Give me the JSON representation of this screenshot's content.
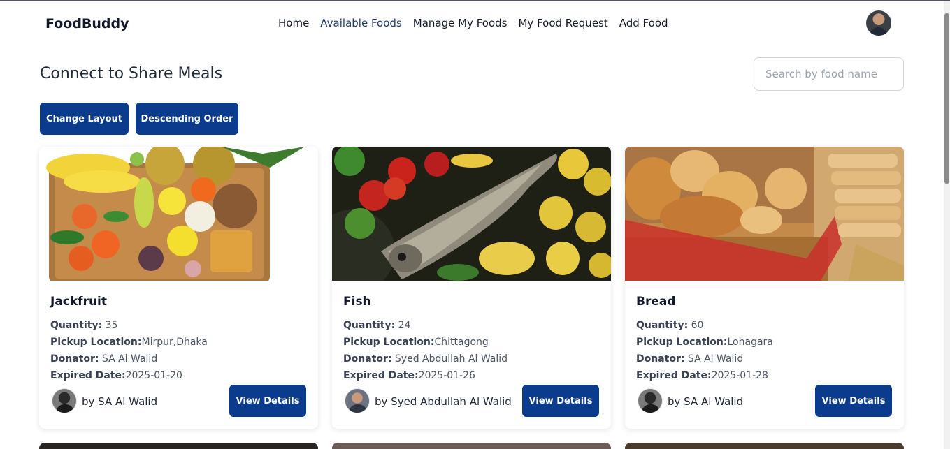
{
  "nav": {
    "brand": "FoodBuddy",
    "links": [
      {
        "label": "Home"
      },
      {
        "label": "Available Foods"
      },
      {
        "label": "Manage My Foods"
      },
      {
        "label": "My Food Request"
      },
      {
        "label": "Add Food"
      }
    ]
  },
  "page": {
    "heading": "Connect to Share Meals",
    "search_placeholder": "Search by food name",
    "change_layout_label": "Change Layout",
    "order_label": "Descending Order"
  },
  "labels": {
    "quantity": "Quantity:",
    "pickup": "Pickup Location:",
    "donator": "Donator:",
    "expired": "Expired Date:",
    "view_details": "View Details"
  },
  "foods": [
    {
      "name": "Jackfruit",
      "quantity": " 35",
      "location": "Mirpur,Dhaka",
      "donator": " SA Al Walid",
      "expired": "2025-01-20",
      "by": "by SA Al Walid"
    },
    {
      "name": "Fish",
      "quantity": " 24",
      "location": "Chittagong",
      "donator": " Syed Abdullah Al Walid",
      "expired": "2025-01-26",
      "by": "by Syed Abdullah Al Walid"
    },
    {
      "name": "Bread",
      "quantity": " 60",
      "location": "Lohagara",
      "donator": " SA Al Walid",
      "expired": "2025-01-28",
      "by": "by SA Al Walid"
    }
  ],
  "colors": {
    "primary": "#0b3b8c",
    "active_link": "#1e3a6e"
  }
}
